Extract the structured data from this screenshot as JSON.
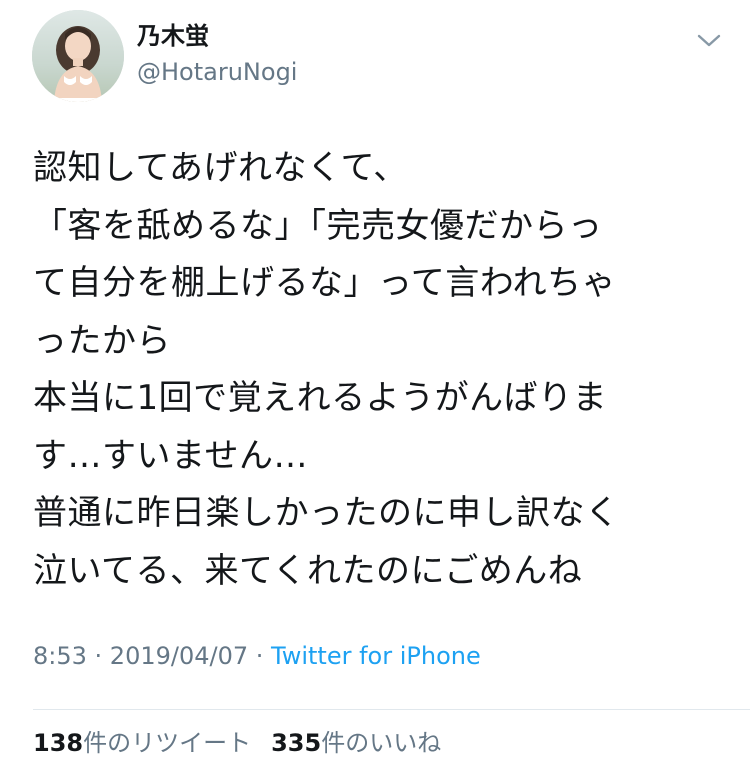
{
  "user": {
    "display_name": "乃木蛍",
    "handle": "@HotaruNogi"
  },
  "tweet": {
    "lines": [
      "認知してあげれなくて、",
      "「客を舐めるな」「完売女優だからっ",
      "て自分を棚上げるな」って言われちゃ",
      "ったから",
      "本当に1回で覚えれるようがんばりま",
      "す…すいません…",
      "普通に昨日楽しかったのに申し訳なく",
      "泣いてる、来てくれたのにごめんね"
    ]
  },
  "meta": {
    "time": "8:53",
    "separator": " · ",
    "date": "2019/04/07",
    "source": "Twitter for iPhone"
  },
  "stats": {
    "retweets_count": "138",
    "retweets_label": "件のリツイート",
    "likes_count": "335",
    "likes_label": "件のいいね"
  },
  "icons": {
    "menu": "chevron-down-icon",
    "avatar": "profile-photo"
  },
  "colors": {
    "text": "#14171a",
    "secondary": "#657786",
    "link": "#1da1f2",
    "divider": "#e1e8ed"
  }
}
